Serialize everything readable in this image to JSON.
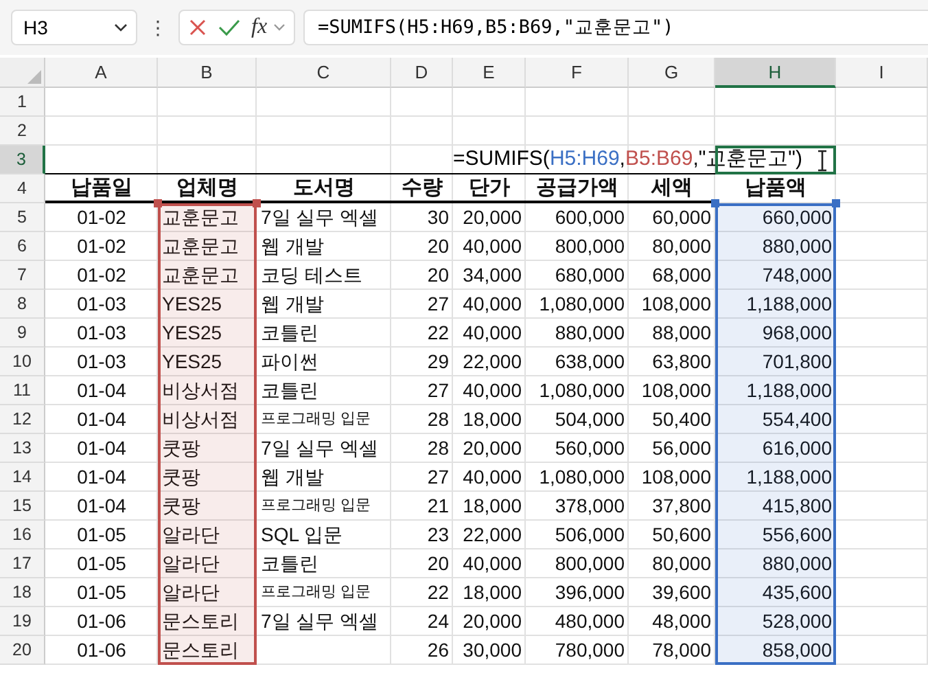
{
  "name_box": {
    "value": "H3"
  },
  "formula_bar": {
    "value": "=SUMIFS(H5:H69,B5:B69,\"교훈문고\")",
    "more": "⋮",
    "function_label": "fx"
  },
  "columns": [
    {
      "label": "A",
      "selected": false
    },
    {
      "label": "B",
      "selected": false,
      "color": "#c0504d"
    },
    {
      "label": "C",
      "selected": false
    },
    {
      "label": "D",
      "selected": false
    },
    {
      "label": "E",
      "selected": false
    },
    {
      "label": "F",
      "selected": false
    },
    {
      "label": "G",
      "selected": false
    },
    {
      "label": "H",
      "selected": true,
      "color": "#3a6fc4"
    },
    {
      "label": "I",
      "selected": false
    }
  ],
  "rows": [
    {
      "number": "1",
      "kind": "blank",
      "selected": false
    },
    {
      "number": "2",
      "kind": "blank",
      "selected": false
    },
    {
      "number": "3",
      "kind": "formula",
      "selected": true,
      "segments": [
        {
          "text": "=SUMIFS(",
          "color": "#000000"
        },
        {
          "text": "H5:H69",
          "color": "#3a6fc4"
        },
        {
          "text": ",",
          "color": "#000000"
        },
        {
          "text": "B5:B69",
          "color": "#c0504d"
        },
        {
          "text": ",\"교훈문고\")",
          "color": "#000000"
        }
      ]
    },
    {
      "number": "4",
      "kind": "header",
      "selected": false,
      "cells": [
        "납품일",
        "업체명",
        "도서명",
        "수량",
        "단가",
        "공급가액",
        "세액",
        "납품액"
      ]
    },
    {
      "number": "5",
      "kind": "data",
      "selected": false,
      "cells": [
        "01-02",
        "교훈문고",
        "7일 실무 엑셀",
        "30",
        "20,000",
        "600,000",
        "60,000",
        "660,000"
      ]
    },
    {
      "number": "6",
      "kind": "data",
      "selected": false,
      "cells": [
        "01-02",
        "교훈문고",
        "웹 개발",
        "20",
        "40,000",
        "800,000",
        "80,000",
        "880,000"
      ]
    },
    {
      "number": "7",
      "kind": "data",
      "selected": false,
      "cells": [
        "01-02",
        "교훈문고",
        "코딩 테스트",
        "20",
        "34,000",
        "680,000",
        "68,000",
        "748,000"
      ]
    },
    {
      "number": "8",
      "kind": "data",
      "selected": false,
      "cells": [
        "01-03",
        "YES25",
        "웹 개발",
        "27",
        "40,000",
        "1,080,000",
        "108,000",
        "1,188,000"
      ]
    },
    {
      "number": "9",
      "kind": "data",
      "selected": false,
      "cells": [
        "01-03",
        "YES25",
        "코틀린",
        "22",
        "40,000",
        "880,000",
        "88,000",
        "968,000"
      ]
    },
    {
      "number": "10",
      "kind": "data",
      "selected": false,
      "cells": [
        "01-03",
        "YES25",
        "파이썬",
        "29",
        "22,000",
        "638,000",
        "63,800",
        "701,800"
      ]
    },
    {
      "number": "11",
      "kind": "data",
      "selected": false,
      "cells": [
        "01-04",
        "비상서점",
        "코틀린",
        "27",
        "40,000",
        "1,080,000",
        "108,000",
        "1,188,000"
      ]
    },
    {
      "number": "12",
      "kind": "data",
      "selected": false,
      "cells": [
        "01-04",
        "비상서점",
        {
          "text": "프로그래밍 입문",
          "small": true
        },
        "28",
        "18,000",
        "504,000",
        "50,400",
        "554,400"
      ]
    },
    {
      "number": "13",
      "kind": "data",
      "selected": false,
      "cells": [
        "01-04",
        "쿳팡",
        "7일 실무 엑셀",
        "28",
        "20,000",
        "560,000",
        "56,000",
        "616,000"
      ]
    },
    {
      "number": "14",
      "kind": "data",
      "selected": false,
      "cells": [
        "01-04",
        "쿳팡",
        "웹 개발",
        "27",
        "40,000",
        "1,080,000",
        "108,000",
        "1,188,000"
      ]
    },
    {
      "number": "15",
      "kind": "data",
      "selected": false,
      "cells": [
        "01-04",
        "쿳팡",
        {
          "text": "프로그래밍 입문",
          "small": true
        },
        "21",
        "18,000",
        "378,000",
        "37,800",
        "415,800"
      ]
    },
    {
      "number": "16",
      "kind": "data",
      "selected": false,
      "cells": [
        "01-05",
        "알라단",
        "SQL 입문",
        "23",
        "22,000",
        "506,000",
        "50,600",
        "556,600"
      ]
    },
    {
      "number": "17",
      "kind": "data",
      "selected": false,
      "cells": [
        "01-05",
        "알라단",
        "코틀린",
        "20",
        "40,000",
        "800,000",
        "80,000",
        "880,000"
      ]
    },
    {
      "number": "18",
      "kind": "data",
      "selected": false,
      "cells": [
        "01-05",
        "알라단",
        {
          "text": "프로그래밍 입문",
          "small": true
        },
        "22",
        "18,000",
        "396,000",
        "39,600",
        "435,600"
      ]
    },
    {
      "number": "19",
      "kind": "data",
      "selected": false,
      "cells": [
        "01-06",
        "문스토리",
        "7일 실무 엑셀",
        "24",
        "20,000",
        "480,000",
        "48,000",
        "528,000"
      ]
    },
    {
      "number": "20",
      "kind": "data",
      "selected": false,
      "cells": [
        "01-06",
        "문스토리",
        null,
        "26",
        "30,000",
        "780,000",
        "78,000",
        "858,000"
      ]
    }
  ]
}
